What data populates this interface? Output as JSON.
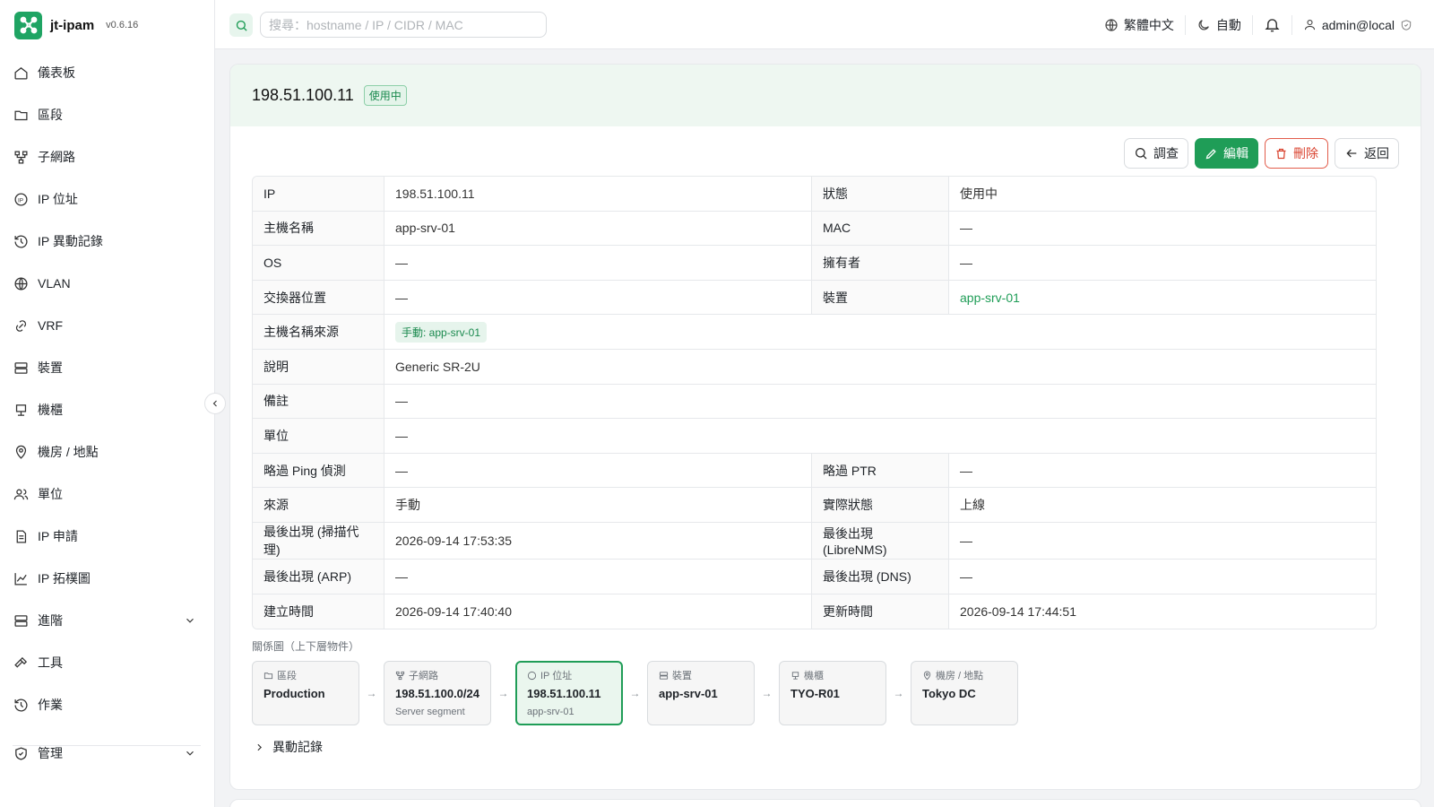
{
  "app": {
    "name": "jt-ipam",
    "version": "v0.6.16",
    "brand_color": "#1fa463",
    "logo_icon": "nodes-icon"
  },
  "sidebar": {
    "items": [
      {
        "label": "儀表板",
        "icon": "home-icon"
      },
      {
        "label": "區段",
        "icon": "folder-icon"
      },
      {
        "label": "子網路",
        "icon": "network-icon"
      },
      {
        "label": "IP 位址",
        "icon": "ip-icon"
      },
      {
        "label": "IP 異動記錄",
        "icon": "history-icon"
      },
      {
        "label": "VLAN",
        "icon": "globe-icon"
      },
      {
        "label": "VRF",
        "icon": "link-icon"
      },
      {
        "label": "裝置",
        "icon": "server-icon"
      },
      {
        "label": "機櫃",
        "icon": "rack-icon"
      },
      {
        "label": "機房 / 地點",
        "icon": "map-pin-icon"
      },
      {
        "label": "單位",
        "icon": "users-icon"
      },
      {
        "label": "IP 申請",
        "icon": "file-icon"
      },
      {
        "label": "IP 拓樸圖",
        "icon": "chart-icon"
      },
      {
        "label": "進階",
        "icon": "server-icon"
      },
      {
        "label": "工具",
        "icon": "hammer-icon"
      },
      {
        "label": "作業",
        "icon": "history-icon"
      },
      {
        "label": "管理",
        "icon": "shield-icon"
      }
    ]
  },
  "topbar": {
    "search_placeholder": "搜尋：hostname / IP / CIDR / MAC",
    "language": "繁體中文",
    "theme": "自動",
    "user": "admin@local"
  },
  "detail": {
    "ip": "198.51.100.11",
    "status_badge": "使用中",
    "buttons": {
      "investigate": "調查",
      "edit": "編輯",
      "delete": "刪除",
      "back": "返回"
    },
    "rows": [
      {
        "k1": "IP",
        "v1": "198.51.100.11",
        "k2": "狀態",
        "v2": "使用中"
      },
      {
        "k1": "主機名稱",
        "v1": "app-srv-01",
        "k2": "MAC",
        "v2": "—"
      },
      {
        "k1": "OS",
        "v1": "—",
        "k2": "擁有者",
        "v2": "—"
      },
      {
        "k1": "交換器位置",
        "v1": "—",
        "k2": "裝置",
        "v2": "app-srv-01"
      },
      {
        "k1": "主機名稱來源",
        "v1": "手動: app-srv-01"
      },
      {
        "k1": "說明",
        "v1": "Generic SR-2U"
      },
      {
        "k1": "備註",
        "v1": "—"
      },
      {
        "k1": "單位",
        "v1": "—"
      },
      {
        "k1": "略過 Ping 偵測",
        "v1": "—",
        "k2": "略過 PTR",
        "v2": "—"
      },
      {
        "k1": "來源",
        "v1": "手動",
        "k2": "實際狀態",
        "v2": "上線"
      },
      {
        "k1": "最後出現 (掃描代理)",
        "v1": "2026-09-14 17:53:35",
        "k2": "最後出現 (LibreNMS)",
        "v2": "—"
      },
      {
        "k1": "最後出現 (ARP)",
        "v1": "—",
        "k2": "最後出現 (DNS)",
        "v2": "—"
      },
      {
        "k1": "建立時間",
        "v1": "2026-09-14 17:40:40",
        "k2": "更新時間",
        "v2": "2026-09-14 17:44:51"
      }
    ]
  },
  "relations": {
    "title": "關係圖（上下層物件）",
    "arrow": "→",
    "nodes": [
      {
        "type": "區段",
        "name": "Production",
        "sub": "",
        "icon": "folder-icon"
      },
      {
        "type": "子網路",
        "name": "198.51.100.0/24",
        "sub": "Server segment",
        "icon": "network-icon"
      },
      {
        "type": "IP 位址",
        "name": "198.51.100.11",
        "sub": "app-srv-01",
        "icon": "ip-icon"
      },
      {
        "type": "裝置",
        "name": "app-srv-01",
        "sub": "",
        "icon": "server-icon"
      },
      {
        "type": "機櫃",
        "name": "TYO-R01",
        "sub": "",
        "icon": "rack-icon"
      },
      {
        "type": "機房 / 地點",
        "name": "Tokyo DC",
        "sub": "",
        "icon": "map-pin-icon"
      }
    ]
  },
  "history": {
    "label": "異動記錄"
  },
  "colors": {
    "primary": "#1f9d57",
    "danger": "#d9432f",
    "header_bg": "#eef7f1"
  }
}
